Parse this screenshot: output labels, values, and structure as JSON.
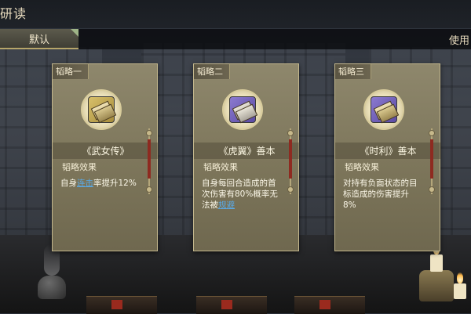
{
  "header": {
    "title": "研读"
  },
  "tabs": {
    "default_label": "默认",
    "use_label": "使用"
  },
  "cards": [
    {
      "corner": "韬略一",
      "title": "《武女传》",
      "effect_label": "韬略效果",
      "desc_before": "自身",
      "desc_link": "连击",
      "desc_after": "率提升12%",
      "icon": "scroll-bundle-icon",
      "icon_color": "#c9a84f"
    },
    {
      "corner": "韬略二",
      "title": "《虎翼》善本",
      "effect_label": "韬略效果",
      "desc_before": "自身每回合造成的首次伤害有80%概率无法被",
      "desc_link": "规避",
      "desc_after": "",
      "icon": "book-bundle-icon",
      "icon_color": "#7565c0"
    },
    {
      "corner": "韬略三",
      "title": "《时利》善本",
      "effect_label": "韬略效果",
      "desc_before": "对持有负面状态的目标造成的伤害提升8%",
      "desc_link": "",
      "desc_after": "",
      "icon": "book-bundle-icon",
      "icon_color": "#7565c0"
    }
  ],
  "colors": {
    "link": "#5aa9e6",
    "card_bg": "#8e876c",
    "accent": "#b6a56a"
  }
}
